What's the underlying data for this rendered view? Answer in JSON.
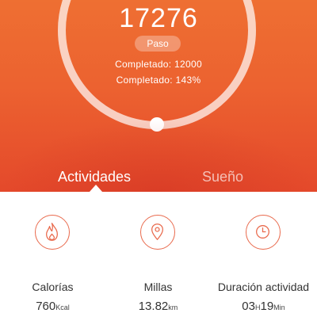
{
  "summary": {
    "steps_value": "17276",
    "unit_label": "Paso",
    "goal_line": "Completado:  12000",
    "percent_line": "Completado:  143%",
    "goal_fraction": 1.0
  },
  "tabs": [
    {
      "label": "Actividades",
      "active": true
    },
    {
      "label": "Sueño",
      "active": false
    }
  ],
  "stats": [
    {
      "label": "Calorías",
      "value": "760",
      "unit": "Kcal",
      "icon": "flame-icon"
    },
    {
      "label": "Millas",
      "value": "13.82",
      "unit": "km",
      "icon": "map-pin-icon"
    },
    {
      "label": "Duración actividad",
      "value_hours": "03",
      "hours_unit": "H",
      "value_minutes": "19",
      "minutes_unit": "Min",
      "icon": "clock-icon"
    }
  ],
  "colors": {
    "hero_top": "#ee6f32",
    "hero_bottom": "#e4492b",
    "accent_icon": "#e96a4d"
  }
}
